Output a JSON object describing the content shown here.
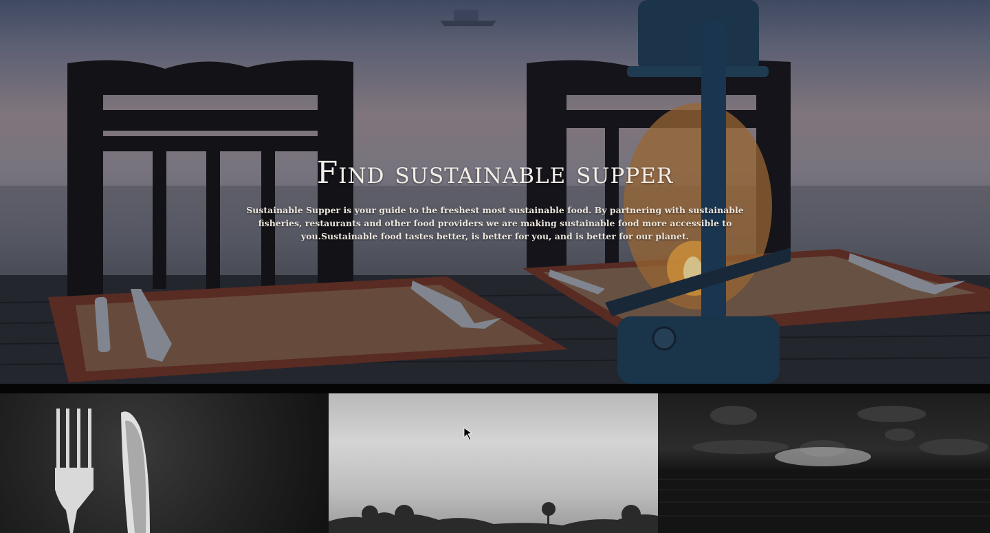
{
  "hero": {
    "title": "Find sustainable supper",
    "description": "Sustainable Supper is your guide to the freshest most sustainable food. By partnering with sustainable fisheries, restaurants and other food providers we are making sustainable food more accessible to you.Sustainable food tastes better, is better for you, and is better for our planet."
  },
  "tiles": [
    {
      "name": "cutlery-photo"
    },
    {
      "name": "sky-trees-photo"
    },
    {
      "name": "sea-clouds-photo"
    }
  ]
}
